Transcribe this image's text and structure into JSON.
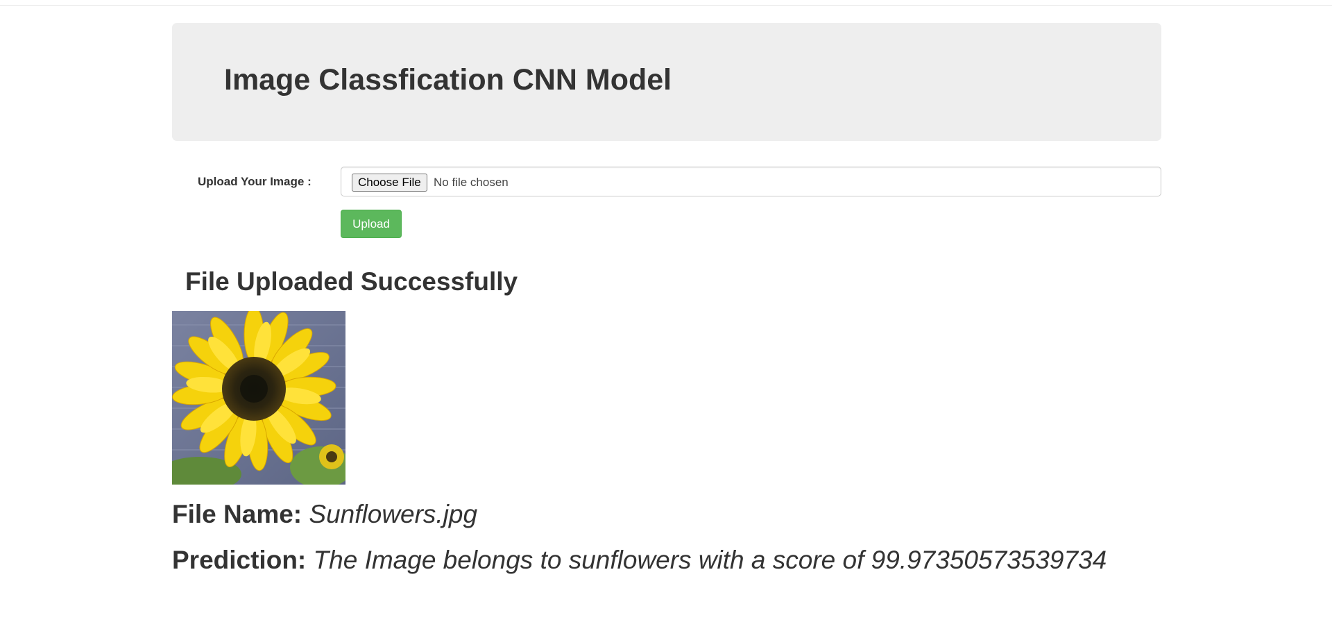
{
  "header": {
    "title": "Image Classfication CNN Model"
  },
  "form": {
    "upload_label": "Upload Your Image :",
    "choose_file_label": "Choose File",
    "file_status": "No file chosen",
    "upload_button": "Upload",
    "accent_color": "#5cb85c"
  },
  "result": {
    "heading": "File Uploaded Successfully",
    "image_alt": "sunflower",
    "file_name_key": "File Name:",
    "file_name_value": "Sunflowers.jpg",
    "prediction_key": "Prediction:",
    "prediction_value": "The Image belongs to sunflowers with a score of 99.97350573539734"
  }
}
